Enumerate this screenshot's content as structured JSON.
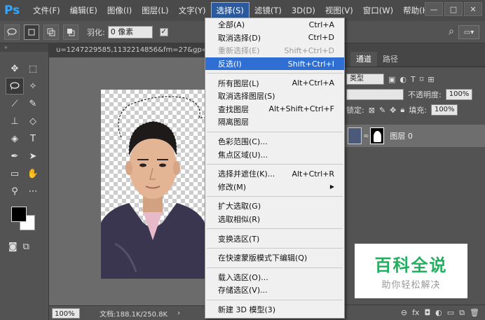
{
  "app": {
    "logo": "Ps"
  },
  "menubar": {
    "items": [
      "文件(F)",
      "编辑(E)",
      "图像(I)",
      "图层(L)",
      "文字(Y)",
      "选择(S)",
      "滤镜(T)",
      "3D(D)",
      "视图(V)",
      "窗口(W)",
      "帮助(H)"
    ],
    "active_index": 5
  },
  "window_controls": {
    "minimize": "—",
    "restore": "□",
    "close": "✕"
  },
  "options_bar": {
    "feather_label": "羽化:",
    "feather_value": "0 像素",
    "antialias_checked": "✓"
  },
  "document": {
    "tab_title": "u=1247229585,1132214856&fm=27&gp=",
    "zoom": "100%",
    "doc_info": "文档:188.1K/250.8K",
    "status_arrow": "›"
  },
  "select_menu": {
    "sections": [
      [
        {
          "label": "全部(A)",
          "shortcut": "Ctrl+A",
          "state": "normal"
        },
        {
          "label": "取消选择(D)",
          "shortcut": "Ctrl+D",
          "state": "normal"
        },
        {
          "label": "重新选择(E)",
          "shortcut": "Shift+Ctrl+D",
          "state": "disabled"
        },
        {
          "label": "反选(I)",
          "shortcut": "Shift+Ctrl+I",
          "state": "highlighted"
        }
      ],
      [
        {
          "label": "所有图层(L)",
          "shortcut": "Alt+Ctrl+A",
          "state": "normal"
        },
        {
          "label": "取消选择图层(S)",
          "shortcut": "",
          "state": "normal"
        },
        {
          "label": "查找图层",
          "shortcut": "Alt+Shift+Ctrl+F",
          "state": "normal"
        },
        {
          "label": "隔离图层",
          "shortcut": "",
          "state": "normal"
        }
      ],
      [
        {
          "label": "色彩范围(C)...",
          "shortcut": "",
          "state": "normal"
        },
        {
          "label": "焦点区域(U)...",
          "shortcut": "",
          "state": "normal"
        }
      ],
      [
        {
          "label": "选择并遮住(K)...",
          "shortcut": "Alt+Ctrl+R",
          "state": "normal"
        },
        {
          "label": "修改(M)",
          "shortcut": "",
          "state": "submenu"
        }
      ],
      [
        {
          "label": "扩大选取(G)",
          "shortcut": "",
          "state": "normal"
        },
        {
          "label": "选取相似(R)",
          "shortcut": "",
          "state": "normal"
        }
      ],
      [
        {
          "label": "变换选区(T)",
          "shortcut": "",
          "state": "normal"
        }
      ],
      [
        {
          "label": "在快速蒙版模式下编辑(Q)",
          "shortcut": "",
          "state": "normal"
        }
      ],
      [
        {
          "label": "载入选区(O)...",
          "shortcut": "",
          "state": "normal"
        },
        {
          "label": "存储选区(V)...",
          "shortcut": "",
          "state": "normal"
        }
      ],
      [
        {
          "label": "新建 3D 模型(3)",
          "shortcut": "",
          "state": "normal"
        }
      ]
    ]
  },
  "layers_panel": {
    "tabs": [
      "通道",
      "路径"
    ],
    "kind_filter": "类型",
    "blend_mode": "",
    "opacity_label": "不透明度:",
    "opacity_value": "100%",
    "lock_label": "锁定:",
    "fill_label": "填充:",
    "fill_value": "100%",
    "layer_name": "图层 0"
  },
  "watermark": {
    "title": "百科全说",
    "subtitle": "助你轻松解决"
  },
  "colors": {
    "highlight": "#2f6fd4",
    "menu_active": "#2b5b9e",
    "watermark_green": "#1fb15e"
  }
}
